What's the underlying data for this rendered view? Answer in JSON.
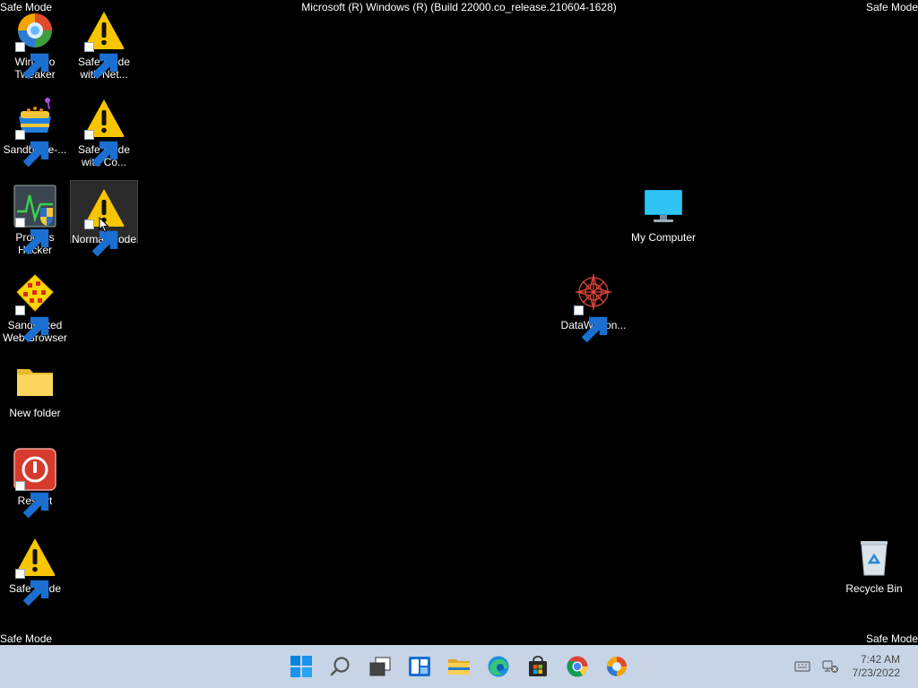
{
  "overlay": {
    "safe_mode_top_left": "Safe Mode",
    "safe_mode_top_right": "Safe Mode",
    "safe_mode_bottom_left": "Safe Mode",
    "safe_mode_bottom_right": "Safe Mode",
    "build_string": "Microsoft (R) Windows (R) (Build 22000.co_release.210604-1628)"
  },
  "desktop_icons": [
    {
      "label": "Winaero Tweaker",
      "icon": "winaero-tweaker-icon"
    },
    {
      "label": "Safe Mode with Net...",
      "icon": "warning-icon"
    },
    {
      "label": "Sandboxie-...",
      "icon": "sandboxie-icon"
    },
    {
      "label": "Safe Mode with Co...",
      "icon": "warning-icon"
    },
    {
      "label": "Process Hacker",
      "icon": "process-hacker-icon"
    },
    {
      "label": "Normal Mode",
      "icon": "warning-icon",
      "selected": true
    },
    {
      "label": "My Computer",
      "icon": "monitor-icon"
    },
    {
      "label": "Sandboxed Web Browser",
      "icon": "sandboxed-browser-icon"
    },
    {
      "label": "DataWagon...",
      "icon": "datawagon-icon"
    },
    {
      "label": "New folder",
      "icon": "folder-icon"
    },
    {
      "label": "Restart",
      "icon": "power-icon"
    },
    {
      "label": "Safe Mode",
      "icon": "warning-icon"
    },
    {
      "label": "Recycle Bin",
      "icon": "recycle-bin-icon"
    }
  ],
  "taskbar": {
    "buttons": [
      {
        "name": "start",
        "icon": "windows-logo-icon"
      },
      {
        "name": "search",
        "icon": "search-icon"
      },
      {
        "name": "task-view",
        "icon": "task-view-icon"
      },
      {
        "name": "widgets",
        "icon": "widgets-icon"
      },
      {
        "name": "file-explorer",
        "icon": "folder-icon"
      },
      {
        "name": "edge",
        "icon": "edge-icon"
      },
      {
        "name": "store",
        "icon": "store-icon"
      },
      {
        "name": "chrome",
        "icon": "chrome-icon"
      },
      {
        "name": "winaero",
        "icon": "winaero-tweaker-icon"
      }
    ],
    "tray": {
      "keyboard_icon": "keyboard-icon",
      "network_icon": "network-disconnected-icon"
    },
    "clock": {
      "time": "7:42 AM",
      "date": "7/23/2022"
    }
  },
  "colors": {
    "desktop_background": "#000000",
    "taskbar_background": "#c6d4e6",
    "warning_yellow": "#f7c600",
    "windows_blue": "#0a84e0"
  }
}
